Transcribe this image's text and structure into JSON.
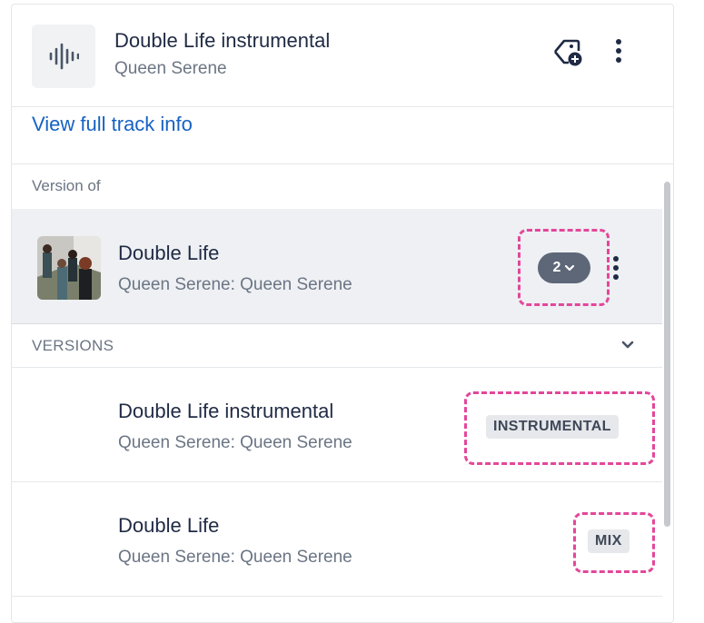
{
  "header": {
    "track_title": "Double Life instrumental",
    "artist": "Queen Serene",
    "icon": "waveform-icon",
    "tag_icon": "tag-add-icon",
    "menu_icon": "more-vertical-icon"
  },
  "view_full_track_info": "View full track info",
  "version_of": {
    "label": "Version of",
    "title": "Double Life",
    "subtitle": "Queen Serene: Queen Serene",
    "versions_count": "2",
    "menu_icon": "more-vertical-icon"
  },
  "versions": {
    "label": "VERSIONS",
    "items": [
      {
        "title": "Double Life instrumental",
        "subtitle": "Queen Serene: Queen Serene",
        "badge": "INSTRUMENTAL"
      },
      {
        "title": "Double Life",
        "subtitle": "Queen Serene: Queen Serene",
        "badge": "MIX"
      }
    ]
  },
  "colors": {
    "link": "#1662c4",
    "highlight": "#e3479a",
    "pill": "#5d6778",
    "selected_bg": "#eef0f3"
  }
}
